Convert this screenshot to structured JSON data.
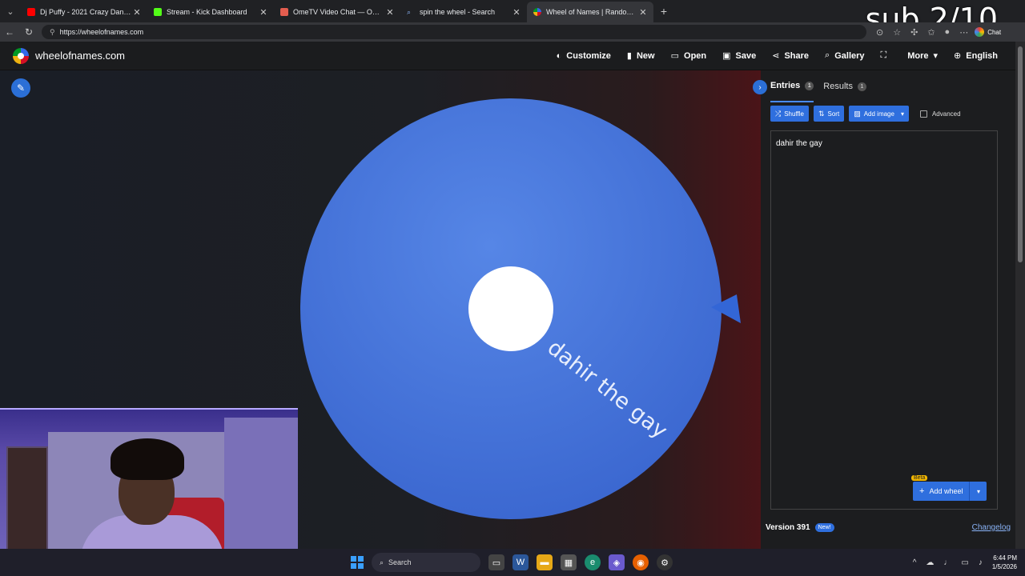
{
  "browser": {
    "tabs": [
      {
        "title": "Dj Puffy - 2021 Crazy Dancehall P",
        "favicon_color": "#ff0000",
        "active": false
      },
      {
        "title": "Stream - Kick Dashboard",
        "favicon_color": "#53fc18",
        "active": false
      },
      {
        "title": "OmeTV Video Chat — Omegle Ra",
        "favicon_color": "#e35d4f",
        "active": false
      },
      {
        "title": "spin the wheel - Search",
        "favicon_color": "#4285f4",
        "active": false
      },
      {
        "title": "Wheel of Names | Random name",
        "favicon_color": "#4285f4",
        "active": true
      }
    ],
    "new_tab_glyph": "+",
    "url": "https://wheelofnames.com",
    "chat_label": "Chat"
  },
  "overlay": {
    "sub_text": "sub 2/10"
  },
  "header": {
    "site_name": "wheelofnames.com",
    "menu": [
      {
        "label": "Customize",
        "icon": "palette-icon",
        "glyph": "◐"
      },
      {
        "label": "New",
        "icon": "file-icon",
        "glyph": "▮"
      },
      {
        "label": "Open",
        "icon": "folder-icon",
        "glyph": "▭"
      },
      {
        "label": "Save",
        "icon": "save-icon",
        "glyph": "▣"
      },
      {
        "label": "Share",
        "icon": "share-icon",
        "glyph": "⋖"
      },
      {
        "label": "Gallery",
        "icon": "search-icon",
        "glyph": "⌕"
      },
      {
        "label": "",
        "icon": "fullscreen-icon",
        "glyph": "⛶"
      },
      {
        "label": "More",
        "icon": "chevron-down-icon",
        "glyph": "▾"
      },
      {
        "label": "English",
        "icon": "globe-icon",
        "glyph": "⊕"
      }
    ]
  },
  "wheel": {
    "segment_label": "dahir the gay",
    "color": "#3e6fd8"
  },
  "panel": {
    "tabs": [
      {
        "label": "Entries",
        "count": "1"
      },
      {
        "label": "Results",
        "count": "1"
      }
    ],
    "toolbar": {
      "shuffle": "Shuffle",
      "sort": "Sort",
      "add_image": "Add image",
      "advanced": "Advanced"
    },
    "entries_text": "dahir the gay",
    "add_wheel": {
      "label": "Add wheel",
      "badge": "Beta"
    },
    "version": "Version 391",
    "new_badge": "New!",
    "changelog": "Changelog"
  },
  "taskbar": {
    "search_label": "Search",
    "time": "6:44 PM",
    "date": "1/5/2026"
  }
}
